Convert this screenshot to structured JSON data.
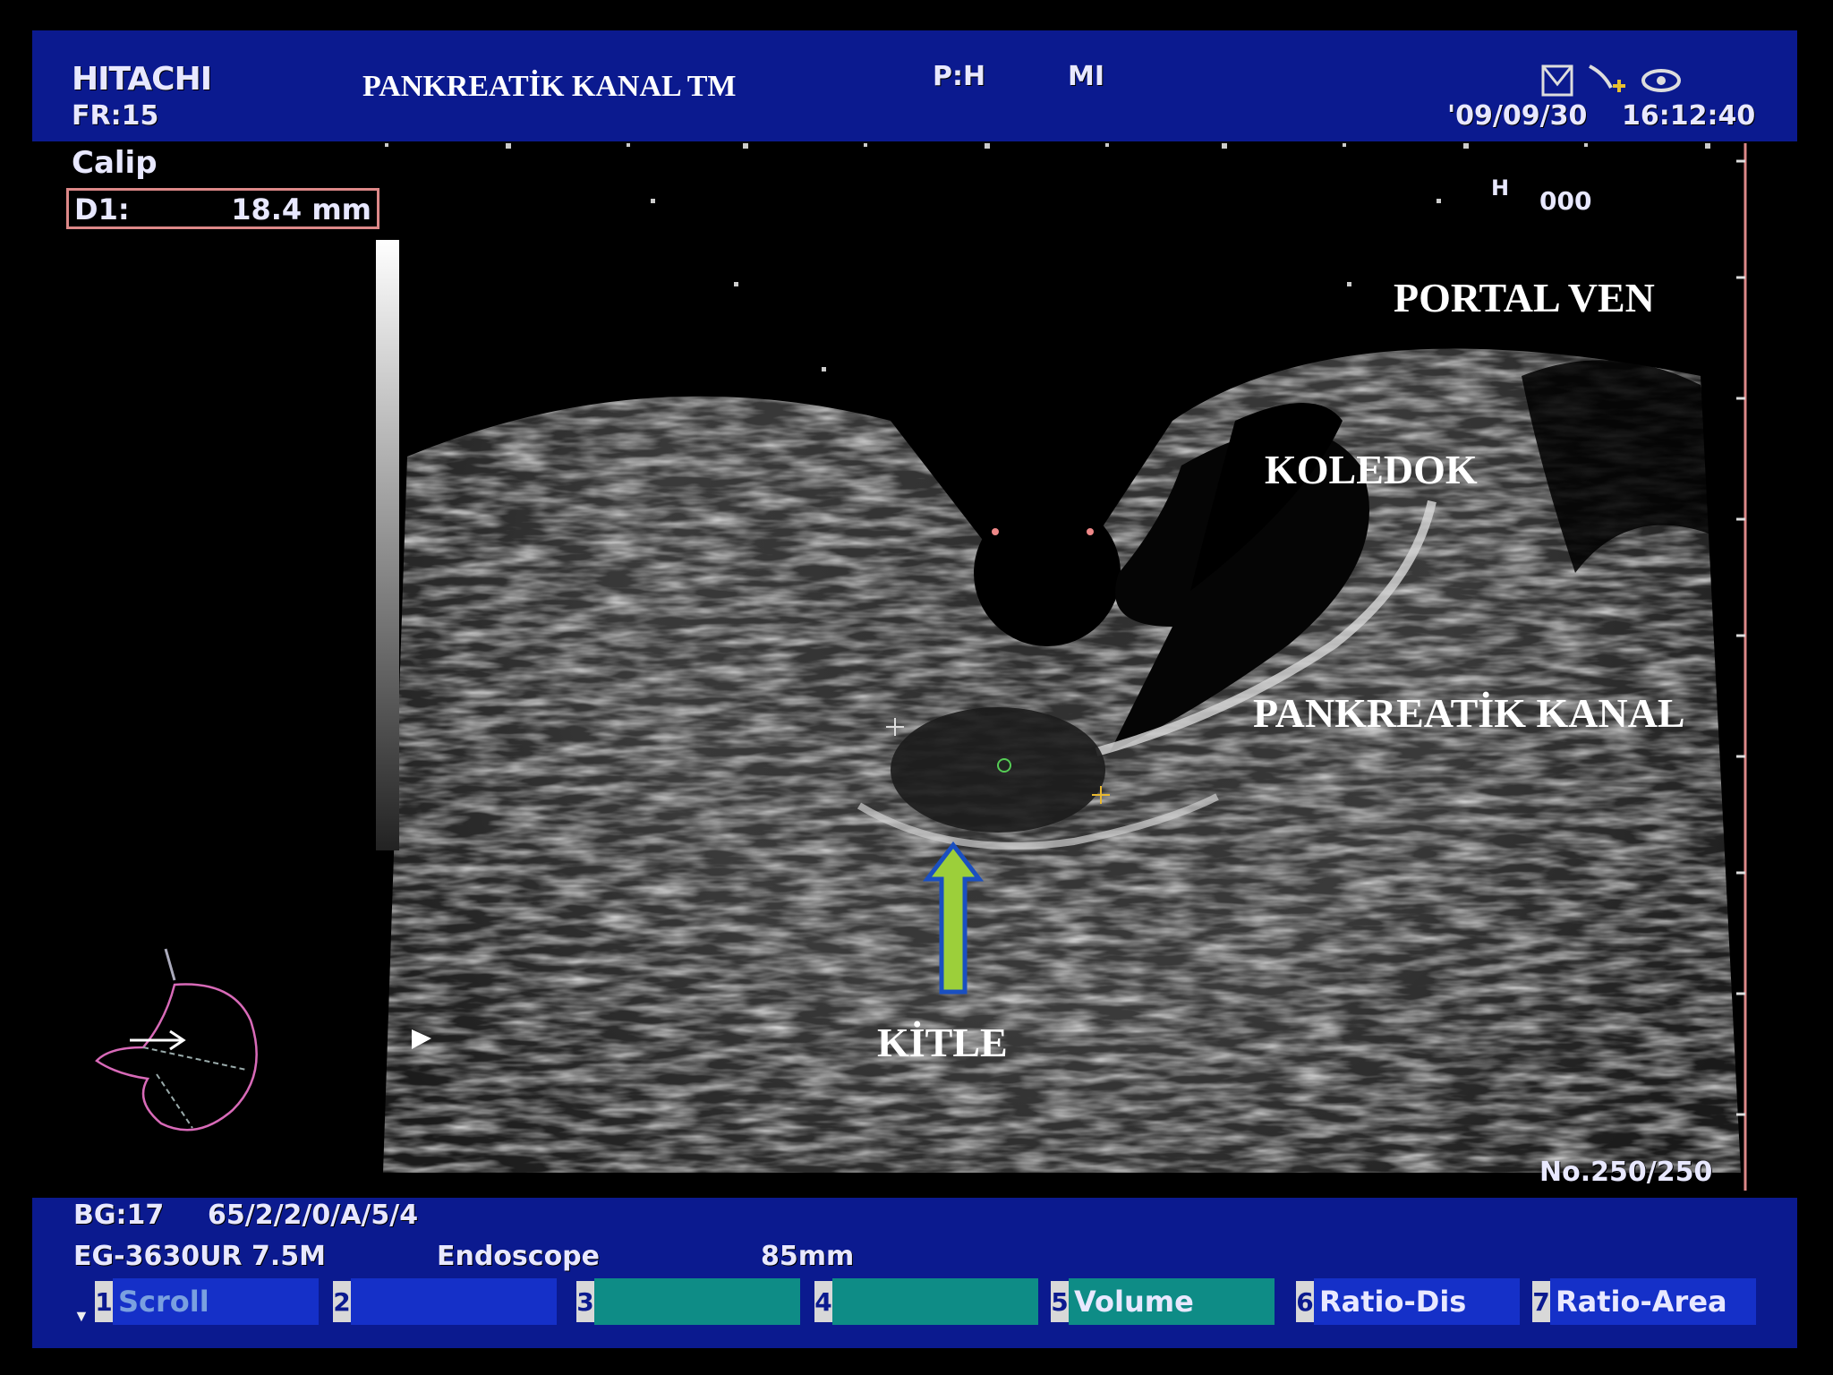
{
  "header": {
    "brand": "HITACHI",
    "frame_rate": "FR:15",
    "title": "PANKREATİK KANAL TM",
    "probe_mode": "P:H",
    "mi": "MI",
    "date": "'09/09/30",
    "time": "16:12:40"
  },
  "caliper": {
    "label": "Calip",
    "d1_label": "D1:",
    "d1_value": "18.4 mm"
  },
  "overlay": {
    "h_marker": "H",
    "h_value": "000",
    "image_counter": "No.250/250"
  },
  "annotations": {
    "portal_ven": "PORTAL VEN",
    "koledok": "KOLEDOK",
    "pankreatik_kanal": "PANKREATİK KANAL",
    "kitle": "KİTLE"
  },
  "footer": {
    "line1_bg": "BG:17",
    "line1_params": "65/2/2/0/A/5/4",
    "probe_model": "EG-3630UR 7.5M",
    "mode": "Endoscope",
    "depth": "85mm"
  },
  "function_keys": [
    {
      "num": "1",
      "label": "Scroll"
    },
    {
      "num": "2",
      "label": ""
    },
    {
      "num": "3",
      "label": ""
    },
    {
      "num": "4",
      "label": ""
    },
    {
      "num": "5",
      "label": "Volume"
    },
    {
      "num": "6",
      "label": "Ratio-Dis"
    },
    {
      "num": "7",
      "label": "Ratio-Area"
    }
  ],
  "colors": {
    "panel_blue": "#0b1a8f",
    "key_blue": "#1530c8",
    "key_teal": "#0e8c86",
    "arrow_fill": "#9ccf3a",
    "arrow_outline": "#1a4fc0"
  }
}
